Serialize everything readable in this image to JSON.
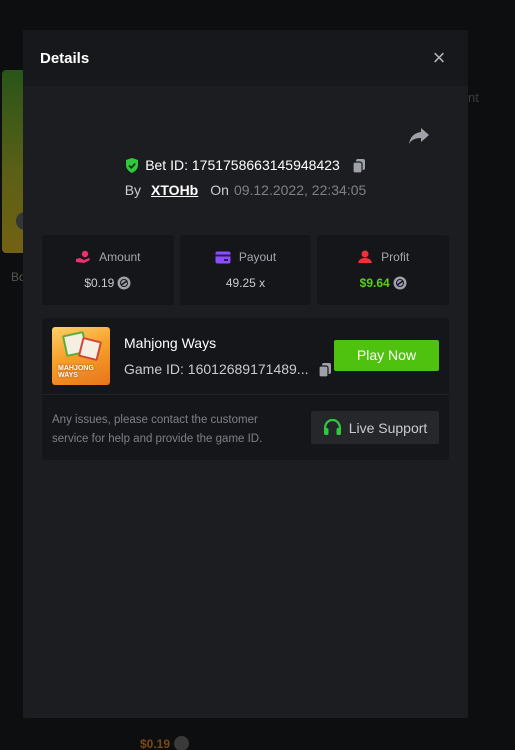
{
  "background": {
    "left_text": "Bo",
    "right_text": "nt",
    "bottom_amount": "$0.19"
  },
  "modal": {
    "title": "Details",
    "bet": {
      "label": "Bet ID: 1751758663145948423",
      "by_label": "By",
      "user": "XTOHb",
      "on_label": "On",
      "date": "09.12.2022, 22:34:05"
    },
    "stats": [
      {
        "label": "Amount",
        "value": "$0.19",
        "icon": "money-hand-icon",
        "color": "#e8336e"
      },
      {
        "label": "Payout",
        "value": "49.25 x",
        "icon": "card-icon",
        "color": "#8b4dff"
      },
      {
        "label": "Profit",
        "value": "$9.64",
        "icon": "person-icon",
        "color": "#e8333a"
      }
    ],
    "game": {
      "name": "Mahjong Ways",
      "game_id": "Game ID: 16012689171489...",
      "play_label": "Play Now",
      "thumb_text": "MAHJONG WAYS"
    },
    "support": {
      "text": "Any issues, please contact the customer service for help and provide the game ID.",
      "button_label": "Live Support"
    }
  },
  "colors": {
    "accent_green": "#4fc20f",
    "profit_green": "#5ad117",
    "shield_green": "#2ec93d"
  }
}
